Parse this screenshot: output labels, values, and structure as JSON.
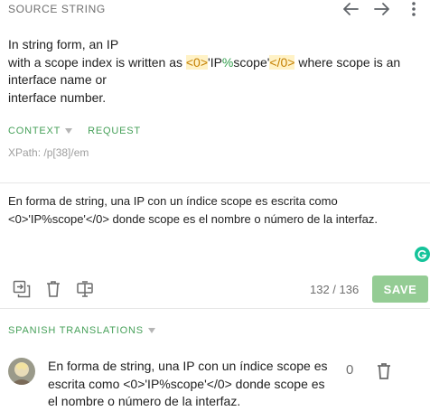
{
  "header": {
    "title": "SOURCE STRING",
    "prev_icon": "arrow-left-icon",
    "next_icon": "arrow-right-icon",
    "menu_icon": "more-vertical-icon"
  },
  "source": {
    "line1": "In string form, an IP",
    "line2_before": "with a scope index is written as ",
    "tag_open": "<0>",
    "quote_open": "'IP",
    "pct": "%",
    "scope": "scope'",
    "tag_close": "</0>",
    "line2_after": " where scope is an interface name or",
    "line3": "interface number."
  },
  "context": {
    "tab_context": "CONTEXT",
    "tab_request": "REQUEST",
    "xpath": "XPath: /p[38]/em"
  },
  "editor": {
    "value": "En forma de string, una IP con un índice scope es escrita como <0>'IP%scope'</0> donde scope es el nombre o número de la interfaz.",
    "char_count": "132 / 136",
    "save_label": "SAVE",
    "tools": [
      "copy-source-icon",
      "trash-icon",
      "machine-translation-icon"
    ]
  },
  "translations": {
    "title": "SPANISH TRANSLATIONS",
    "items": [
      {
        "text": "En forma de string, una IP con un índice scope es escrita como <0>'IP%scope'</0> donde scope es el nombre o número de la interfaz.",
        "votes": "0"
      }
    ]
  },
  "colors": {
    "accent_green": "#47a15a",
    "save_button": "#94cc94",
    "placeholder_bg": "#fff2c6",
    "placeholder_fg": "#c47f00"
  }
}
